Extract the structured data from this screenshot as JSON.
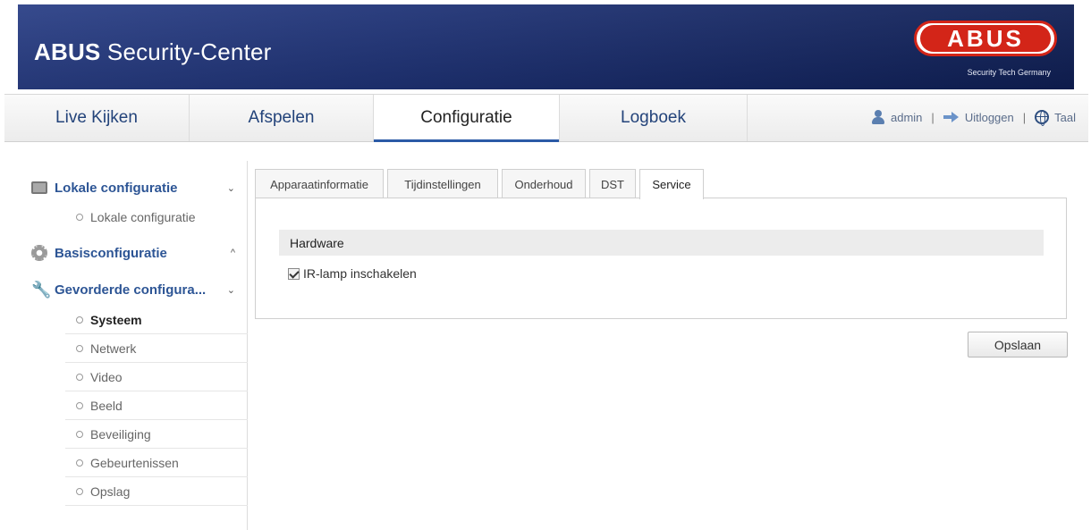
{
  "header": {
    "brand_bold": "ABUS",
    "brand_rest": " Security-Center",
    "logo_text": "ABUS",
    "logo_tagline": "Security Tech Germany"
  },
  "nav": {
    "tabs": [
      {
        "label": "Live Kijken"
      },
      {
        "label": "Afspelen"
      },
      {
        "label": "Configuratie",
        "active": true
      },
      {
        "label": "Logboek"
      }
    ],
    "user": "admin",
    "logout": "Uitloggen",
    "language": "Taal",
    "separator": "|"
  },
  "sidebar": {
    "groups": [
      {
        "label": "Lokale configuratie",
        "chevron": "⌄",
        "icon": "monitor-icon"
      },
      {
        "label": "Basisconfiguratie",
        "chevron": "^",
        "icon": "gear-icon"
      },
      {
        "label": "Gevorderde configura...",
        "chevron": "⌄",
        "icon": "wrench-icon"
      }
    ],
    "local_sub": "Lokale configuratie",
    "items": [
      {
        "label": "Systeem",
        "active": true
      },
      {
        "label": "Netwerk"
      },
      {
        "label": "Video"
      },
      {
        "label": "Beeld"
      },
      {
        "label": "Beveiliging"
      },
      {
        "label": "Gebeurtenissen"
      },
      {
        "label": "Opslag"
      }
    ]
  },
  "content": {
    "tabs": [
      {
        "label": "Apparaatinformatie"
      },
      {
        "label": "Tijdinstellingen"
      },
      {
        "label": "Onderhoud"
      },
      {
        "label": "DST"
      },
      {
        "label": "Service",
        "active": true
      }
    ],
    "section_title": "Hardware",
    "checkbox_label": "IR-lamp inschakelen",
    "checkbox_checked": true,
    "save_label": "Opslaan"
  },
  "colors": {
    "banner": "#1f3377",
    "brand_red": "#d32518",
    "link_blue": "#2d5595"
  }
}
